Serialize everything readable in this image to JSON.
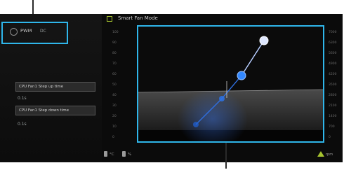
{
  "mode": {
    "label": "PWM",
    "value": "DC"
  },
  "left": {
    "step_up": {
      "label": "CPU Fan1 Step up time",
      "value": "0.1s"
    },
    "step_down": {
      "label": "CPU Fan1 Step down time",
      "value": "0.1s"
    }
  },
  "graph": {
    "title": "Smart Fan Mode",
    "y_ticks_left": [
      "100",
      "90",
      "80",
      "70",
      "60",
      "50",
      "40",
      "30",
      "20",
      "10",
      "0"
    ],
    "y_ticks_right": [
      "7000",
      "6300",
      "5600",
      "4900",
      "4200",
      "3500",
      "2800",
      "2100",
      "1400",
      "700",
      "0"
    ],
    "legend": [
      "°C",
      "%"
    ],
    "unit": "rpm"
  },
  "colors": {
    "accent": "#2fb6ea",
    "panel_bg": "#0b0b0b",
    "curve": "#9bc3ff",
    "point_active": "#1f63d9",
    "point_fill": "#3388ff",
    "logo": "#a6c32f"
  },
  "icons": [
    "radio-icon",
    "graph-icon",
    "temperature-legend-icon",
    "fan-legend-icon",
    "logo-icon"
  ]
}
